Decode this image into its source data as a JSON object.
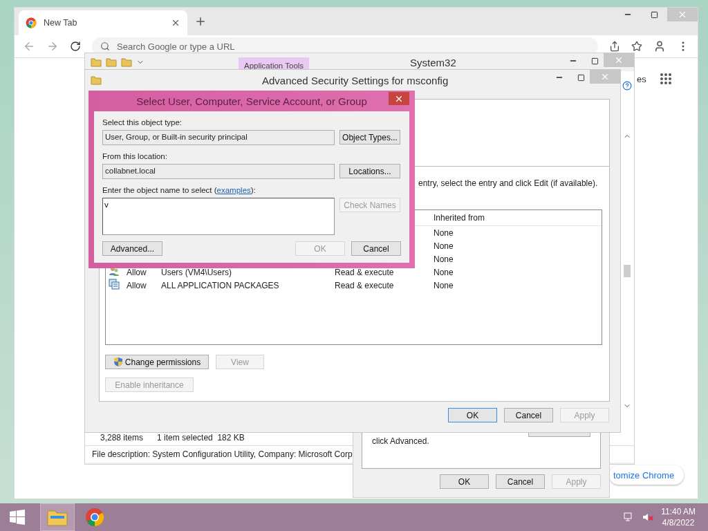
{
  "browser": {
    "tab": {
      "title": "New Tab",
      "selected": true
    },
    "address": {
      "placeholder": "Search Google or type a URL"
    },
    "link_fragment": "es",
    "customize_button": "tomize Chrome"
  },
  "explorer": {
    "ribbon_tab": "Application Tools",
    "title": "System32",
    "status": {
      "items": "3,288 items",
      "selection": "1 item selected  182 KB"
    },
    "details": "File description: System Configuration Utility, Company: Microsoft Corp"
  },
  "properties": {
    "text": "click Advanced.",
    "buttons": [
      {
        "label": "OK",
        "disabled": false
      },
      {
        "label": "Cancel",
        "disabled": false
      },
      {
        "label": "Apply",
        "disabled": true
      }
    ]
  },
  "security": {
    "title": "Advanced Security Settings for msconfig",
    "instruction": "entry, select the entry and click Edit (if available).",
    "column": "Inherited from",
    "rows": [
      {
        "inherited": "None"
      },
      {
        "inherited": "None"
      },
      {
        "inherited": "None"
      },
      {
        "kind": "users",
        "type": "Allow",
        "principal": "Users (VM4\\Users)",
        "access": "Read & execute",
        "inherited": "None"
      },
      {
        "kind": "packages",
        "type": "Allow",
        "principal": "ALL APPLICATION PACKAGES",
        "access": "Read & execute",
        "inherited": "None"
      }
    ],
    "actions": [
      {
        "label": "Change permissions",
        "kind": "shield",
        "disabled": false
      },
      {
        "label": "View",
        "kind": "plain",
        "disabled": true
      },
      {
        "label": "Enable inheritance",
        "kind": "plain",
        "disabled": true
      }
    ],
    "buttons": [
      {
        "label": "OK",
        "disabled": false,
        "default": true
      },
      {
        "label": "Cancel",
        "disabled": false,
        "default": false
      },
      {
        "label": "Apply",
        "disabled": true,
        "default": false
      }
    ]
  },
  "select_dialog": {
    "title": "Select User, Computer, Service Account, or Group",
    "object_type": {
      "label": "Select this object type:",
      "value": "User, Group, or Built-in security principal",
      "button": "Object Types..."
    },
    "location": {
      "label": "From this location:",
      "value": "collabnet.local",
      "button": "Locations..."
    },
    "name_entry": {
      "label": "Enter the object name to select (",
      "link": "examples",
      "label_end": "):",
      "value": "v",
      "button": "Check Names",
      "button_disabled": true
    },
    "buttons": [
      {
        "label": "Advanced...",
        "disabled": false
      },
      {
        "label": "OK",
        "disabled": true
      },
      {
        "label": "Cancel",
        "disabled": false
      }
    ]
  },
  "taskbar": {
    "apps": [
      {
        "kind": "explorer",
        "selected": true
      },
      {
        "kind": "chrome",
        "selected": false
      }
    ],
    "clock": {
      "time": "11:40 AM",
      "date": "4/8/2022"
    }
  }
}
